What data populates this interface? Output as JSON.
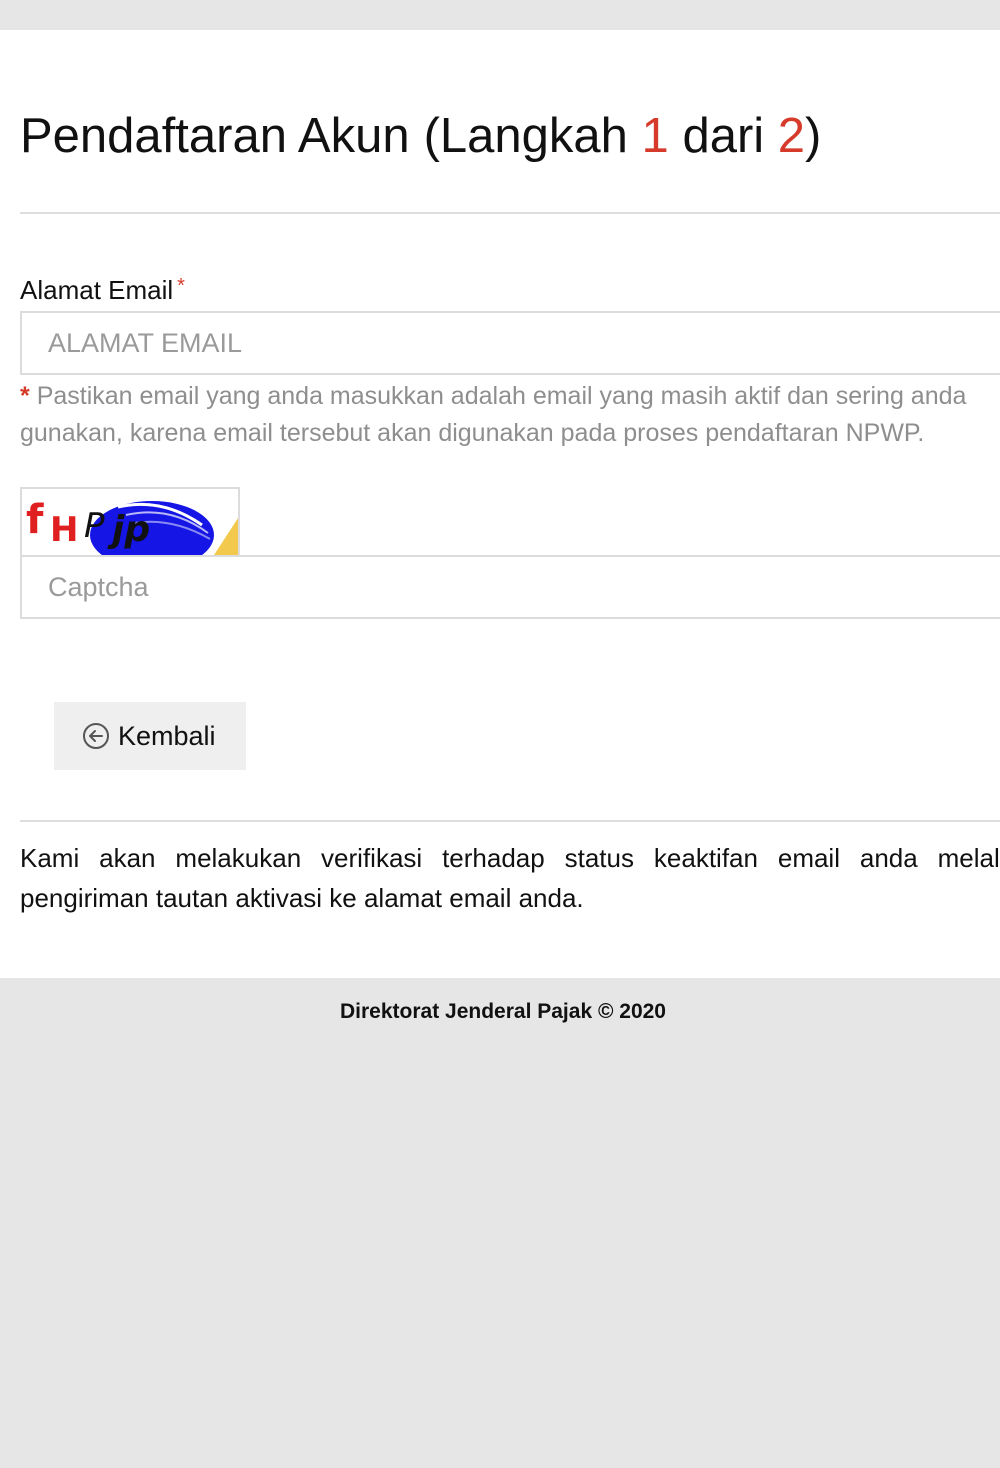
{
  "page": {
    "title": {
      "main": "Pendaftaran Akun",
      "step_open": "(Langkah",
      "step_current": "1",
      "step_of": "dari",
      "step_total": "2",
      "step_close": ")"
    }
  },
  "form": {
    "email": {
      "label": "Alamat Email",
      "required_mark": "*",
      "placeholder": "ALAMAT EMAIL",
      "value": "",
      "help_star": "*",
      "help_text": "Pastikan email yang anda masukkan adalah email yang masih aktif dan sering anda gunakan, karena email tersebut akan digunakan pada proses pendaftaran NPWP."
    },
    "captcha": {
      "image_text": "fHPjp",
      "placeholder": "Captcha",
      "value": ""
    },
    "back_button": {
      "label": "Kembali",
      "icon": "circle-arrow-left-icon"
    }
  },
  "info": {
    "text": "Kami akan melakukan verifikasi terhadap status keaktifan email anda melalui pengiriman tautan aktivasi ke alamat email anda."
  },
  "footer": {
    "text": "Direktorat Jenderal Pajak © 2020"
  },
  "colors": {
    "accent_red": "#d63a2a",
    "background_gray": "#e6e6e6",
    "button_gray": "#efefef"
  }
}
